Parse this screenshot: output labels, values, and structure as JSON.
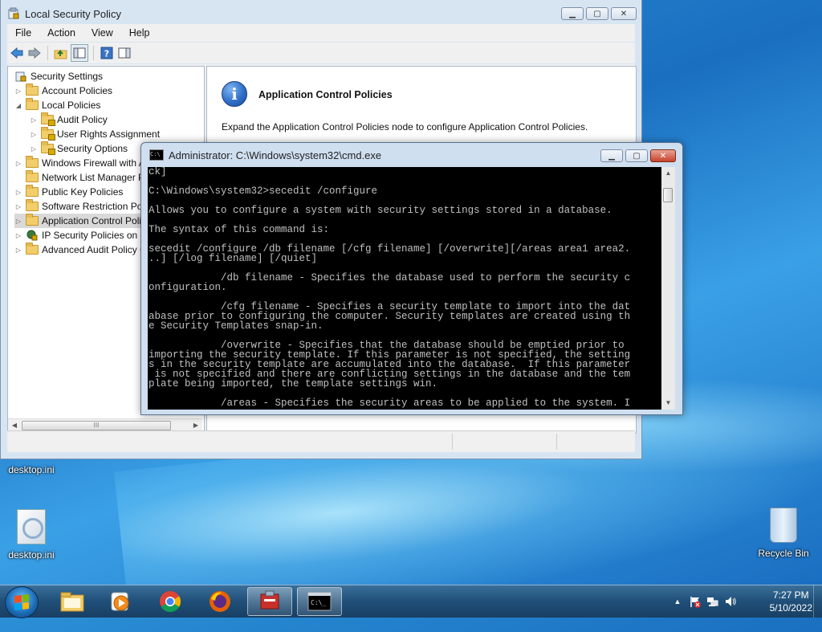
{
  "lsp": {
    "title": "Local Security Policy",
    "menu": [
      "File",
      "Action",
      "View",
      "Help"
    ],
    "tree": [
      {
        "label": "Security Settings",
        "level": 0,
        "arrow": "",
        "icon": "security-settings-icon"
      },
      {
        "label": "Account Policies",
        "level": 1,
        "arrow": "▷",
        "icon": "folder-icon"
      },
      {
        "label": "Local Policies",
        "level": 1,
        "arrow": "◢",
        "icon": "folder-icon"
      },
      {
        "label": "Audit Policy",
        "level": 2,
        "arrow": "▷",
        "icon": "folder-lock-icon"
      },
      {
        "label": "User Rights Assignment",
        "level": 2,
        "arrow": "▷",
        "icon": "folder-lock-icon"
      },
      {
        "label": "Security Options",
        "level": 2,
        "arrow": "▷",
        "icon": "folder-lock-icon"
      },
      {
        "label": "Windows Firewall with Advanced Security",
        "level": 1,
        "arrow": "▷",
        "icon": "folder-icon"
      },
      {
        "label": "Network List Manager Policies",
        "level": 1,
        "arrow": "",
        "icon": "folder-icon"
      },
      {
        "label": "Public Key Policies",
        "level": 1,
        "arrow": "▷",
        "icon": "folder-icon"
      },
      {
        "label": "Software Restriction Policies",
        "level": 1,
        "arrow": "▷",
        "icon": "folder-icon"
      },
      {
        "label": "Application Control Policies",
        "level": 1,
        "arrow": "▷",
        "icon": "folder-icon"
      },
      {
        "label": "IP Security Policies on Local Computer",
        "level": 1,
        "arrow": "▷",
        "icon": "ip-security-icon"
      },
      {
        "label": "Advanced Audit Policy Configuration",
        "level": 1,
        "arrow": "▷",
        "icon": "folder-icon"
      }
    ],
    "detail": {
      "title": "Application Control Policies",
      "description": "Expand the Application Control Policies node to configure Application Control Policies."
    }
  },
  "cmd": {
    "title": "Administrator: C:\\Windows\\system32\\cmd.exe",
    "output": "ck]\n\nC:\\Windows\\system32>secedit /configure\n\nAllows you to configure a system with security settings stored in a database.\n\nThe syntax of this command is:\n\nsecedit /configure /db filename [/cfg filename] [/overwrite][/areas area1 area2.\n..] [/log filename] [/quiet]\n\n            /db filename - Specifies the database used to perform the security c\nonfiguration.\n\n            /cfg filename - Specifies a security template to import into the dat\nabase prior to configuring the computer. Security templates are created using th\ne Security Templates snap-in.\n\n            /overwrite - Specifies that the database should be emptied prior to\nimporting the security template. If this parameter is not specified, the setting\ns in the security template are accumulated into the database.  If this parameter\n is not specified and there are conflicting settings in the database and the tem\nplate being imported, the template settings win.\n\n            /areas - Specifies the security areas to be applied to the system. I"
  },
  "desktop": {
    "icons": [
      {
        "label": "desktop.ini"
      },
      {
        "label": "desktop.ini"
      },
      {
        "label": "Recycle Bin"
      }
    ]
  },
  "taskbar": {
    "time": "7:27 PM",
    "date": "5/10/2022",
    "tray_arrow": "▲",
    "scrollbar_grip": "III"
  }
}
